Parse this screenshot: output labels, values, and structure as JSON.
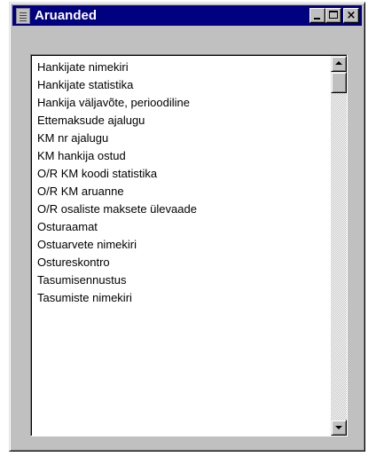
{
  "window": {
    "title": "Aruanded",
    "icon": "document-list-icon",
    "controls": {
      "minimize": "minimize-icon",
      "maximize": "maximize-icon",
      "close_label": "×"
    }
  },
  "list": {
    "items": [
      "Hankijate nimekiri",
      "Hankijate statistika",
      "Hankija väljavõte, perioodiline",
      "Ettemaksude ajalugu",
      "KM nr ajalugu",
      "KM hankija ostud",
      "O/R KM koodi statistika",
      "O/R KM aruanne",
      "O/R osaliste maksete ülevaade",
      "Osturaamat",
      "Ostuarvete nimekiri",
      "Ostureskontro",
      "Tasumisennustus",
      "Tasumiste nimekiri"
    ]
  },
  "scrollbar": {
    "up_icon": "scroll-up-arrow-icon",
    "down_icon": "scroll-down-arrow-icon",
    "position": 0
  }
}
